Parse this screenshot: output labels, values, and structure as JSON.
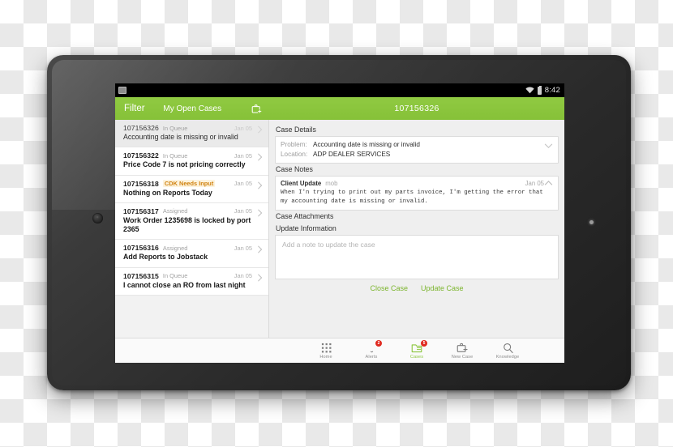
{
  "status_bar": {
    "notification_icon": "screenshot-icon",
    "wifi_icon": "wifi-icon",
    "battery_icon": "battery-icon",
    "time": "8:42"
  },
  "list_header": {
    "filter_label": "Filter",
    "title": "My Open Cases",
    "new_case_icon": "new-case-icon"
  },
  "detail_header": {
    "case_id": "107156326"
  },
  "cases": [
    {
      "id": "107156326",
      "status": "In Queue",
      "date": "Jan 05",
      "subject": "Accounting date is missing or invalid",
      "selected": true,
      "highlight": false
    },
    {
      "id": "107156322",
      "status": "In Queue",
      "date": "Jan 05",
      "subject": "Price Code 7 is not pricing correctly",
      "selected": false,
      "highlight": false
    },
    {
      "id": "107156318",
      "status": "CDK Needs Input",
      "date": "Jan 05",
      "subject": "Nothing on Reports Today",
      "selected": false,
      "highlight": true
    },
    {
      "id": "107156317",
      "status": "Assigned",
      "date": "Jan 05",
      "subject": "Work Order 1235698 is locked by port 2365",
      "selected": false,
      "highlight": false
    },
    {
      "id": "107156316",
      "status": "Assigned",
      "date": "Jan 05",
      "subject": "Add Reports to Jobstack",
      "selected": false,
      "highlight": false
    },
    {
      "id": "107156315",
      "status": "In Queue",
      "date": "Jan 05",
      "subject": "I cannot close an RO from last night",
      "selected": false,
      "highlight": false
    }
  ],
  "detail": {
    "case_details_title": "Case Details",
    "problem_label": "Problem:",
    "problem_value": "Accounting date is missing or invalid",
    "location_label": "Location:",
    "location_value": "ADP DEALER SERVICES",
    "details_chevron_icon": "chevron-down-icon",
    "case_notes_title": "Case Notes",
    "note": {
      "author": "Client Update",
      "channel": "mob",
      "date": "Jan 05",
      "chevron_icon": "chevron-up-icon",
      "body": "When I'n trying to print out my parts invoice, I'm getting the error that my accounting date is missing or invalid."
    },
    "case_attachments_title": "Case Attachments",
    "update_information_title": "Update Information",
    "update_placeholder": "Add a note to update the case",
    "close_case_label": "Close Case",
    "update_case_label": "Update Case"
  },
  "tabbar": [
    {
      "label": "Home",
      "icon": "grid-icon",
      "badge": "",
      "active": false
    },
    {
      "label": "Alerts",
      "icon": "bell-icon",
      "badge": "2",
      "active": false
    },
    {
      "label": "Cases",
      "icon": "cases-icon",
      "badge": "5",
      "active": true
    },
    {
      "label": "New Case",
      "icon": "new-case-icon",
      "badge": "",
      "active": false
    },
    {
      "label": "Knowledge",
      "icon": "search-icon",
      "badge": "",
      "active": false
    }
  ],
  "navbar": {
    "back_icon": "back-icon",
    "home_icon": "home-icon",
    "recents_icon": "recents-icon"
  },
  "colors": {
    "brand_green": "#8cc63e",
    "action_green": "#7cb52e",
    "badge_red": "#e02a20",
    "needs_input_orange": "#d08312"
  }
}
